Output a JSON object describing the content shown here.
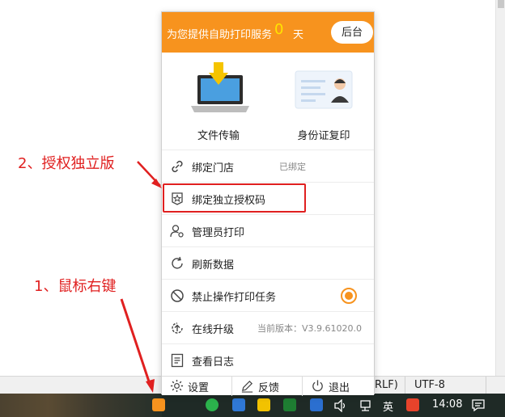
{
  "popup": {
    "header": {
      "slogan": "为您提供自助打印服务",
      "days_value": "0",
      "days_unit": "天",
      "backend_button": "后台"
    },
    "features": [
      {
        "label": "文件传输",
        "icon": "laptop-upload-icon"
      },
      {
        "label": "身份证复印",
        "icon": "id-card-icon"
      }
    ],
    "menu": [
      {
        "label": "绑定门店",
        "icon": "link-icon",
        "status": "已绑定"
      },
      {
        "label": "绑定独立授权码",
        "icon": "star-badge-icon"
      },
      {
        "label": "管理员打印",
        "icon": "admin-user-icon"
      },
      {
        "label": "刷新数据",
        "icon": "refresh-icon"
      },
      {
        "label": "禁止操作打印任务",
        "icon": "forbid-icon",
        "toggle": true
      },
      {
        "label": "在线升级",
        "icon": "upgrade-icon",
        "version": "当前版本：V3.9.61020.0"
      },
      {
        "label": "查看日志",
        "icon": "log-icon"
      }
    ],
    "footer": [
      {
        "label": "设置",
        "icon": "gear-icon"
      },
      {
        "label": "反馈",
        "icon": "edit-icon"
      },
      {
        "label": "退出",
        "icon": "power-icon"
      }
    ],
    "accent_color": "#f7931e"
  },
  "annotations": {
    "step1": "1、鼠标右键",
    "step2": "2、授权独立版",
    "color": "#e02020"
  },
  "statusbar": {
    "line_ending": "RLF)",
    "encoding": "UTF-8"
  },
  "taskbar": {
    "ime": "英",
    "clock": "14:08"
  }
}
